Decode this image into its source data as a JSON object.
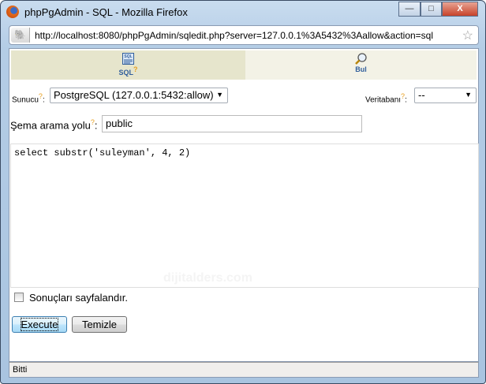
{
  "window": {
    "title": "phpPgAdmin - SQL - Mozilla Firefox",
    "controls": {
      "minimize": "—",
      "maximize": "□",
      "close": "X"
    }
  },
  "address_bar": {
    "url": "http://localhost:8080/phpPgAdmin/sqledit.php?server=127.0.0.1%3A5432%3Aallow&action=sql"
  },
  "tabs": [
    {
      "label": "SQL",
      "help": "?",
      "icon": "sql-icon",
      "active": true
    },
    {
      "label": "Bul",
      "icon": "magnifier-icon",
      "active": false
    }
  ],
  "form": {
    "server_label": "Sunucu",
    "server_help": "?",
    "server_sep": ":",
    "server_value": "PostgreSQL (127.0.0.1:5432:allow)",
    "db_label": "Veritabanı",
    "db_help": "?",
    "db_sep": ":",
    "db_value": "--",
    "schema_label": "Şema arama yolu",
    "schema_help": "?",
    "schema_sep": ":",
    "schema_value": "public",
    "query": "select substr('suleyman', 4, 2)",
    "paginate_label": "Sonuçları sayfalandır.",
    "paginate_checked": false,
    "execute_label": "Execute",
    "clear_label": "Temizle"
  },
  "watermark": "dijitalders.com",
  "status": "Bitti"
}
